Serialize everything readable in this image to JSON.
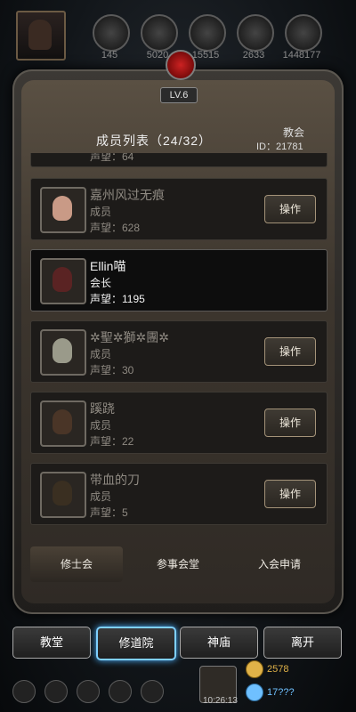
{
  "hud": {
    "stats": [
      "145",
      "5020",
      "15515",
      "2633",
      "1448177"
    ],
    "level": "LV.6"
  },
  "panel": {
    "title": "成员列表（24/32）",
    "church_label": "教会",
    "church_id": "ID：21781"
  },
  "partial_row": {
    "reputation": "声望：64"
  },
  "members": [
    {
      "name": "嘉州风过无痕",
      "role": "成员",
      "reputation": "声望：628",
      "action": "操作",
      "avatar_color": "#c99a86"
    },
    {
      "name": "Ellin喵",
      "role": "会长",
      "reputation": "声望：1195",
      "action": "",
      "avatar_color": "#5a2323"
    },
    {
      "name": "✲聖✲獅✲團✲",
      "role": "成员",
      "reputation": "声望：30",
      "action": "操作",
      "avatar_color": "#9a9a8a"
    },
    {
      "name": "蹊跷",
      "role": "成员",
      "reputation": "声望：22",
      "action": "操作",
      "avatar_color": "#4a3527"
    },
    {
      "name": "带血的刀",
      "role": "成员",
      "reputation": "声望：5",
      "action": "操作",
      "avatar_color": "#3a2f21"
    }
  ],
  "tabs": [
    "修士会",
    "参事会堂",
    "入会申请"
  ],
  "nav": [
    "教堂",
    "修道院",
    "神庙",
    "离开"
  ],
  "resources": {
    "gold": "2578",
    "gem": "17???",
    "time": "10:26:13"
  },
  "colors": {
    "accent": "#7fd0ff",
    "gold": "#e0b248",
    "gem": "#6fc0ff"
  }
}
